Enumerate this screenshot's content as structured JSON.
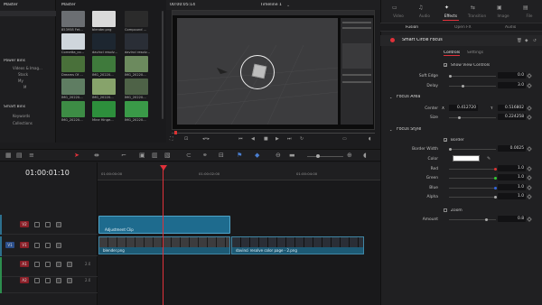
{
  "media_pool": {
    "master_label": "Master",
    "bins_master": "Master",
    "power_bins": "Power Bins",
    "power_items": [
      "Videos & Imag...",
      "Stock",
      "My",
      "M"
    ],
    "smart_bins": "Smart Bins",
    "smart_items": [
      "Keywords",
      "Collections"
    ],
    "thumbs": [
      {
        "label": "853958 Fet...",
        "color": "#6b6e72"
      },
      {
        "label": "blender.png",
        "color": "#dadada"
      },
      {
        "label": "Compound ...",
        "color": "#2b2b2b"
      },
      {
        "label": "Cornetta_co...",
        "color": "#cfd6dc"
      },
      {
        "label": "davinci resolv...",
        "color": "#1d2630"
      },
      {
        "label": "davinci resolv...",
        "color": "#2a2e36"
      },
      {
        "label": "Dreams Of ...",
        "color": "#49703a"
      },
      {
        "label": "IMG_20220...",
        "color": "#3f7a3c"
      },
      {
        "label": "IMG_20220...",
        "color": "#6c8a5e"
      },
      {
        "label": "IMG_20220...",
        "color": "#5f7d62"
      },
      {
        "label": "IMG_20220...",
        "color": "#87a36b"
      },
      {
        "label": "IMG_20220...",
        "color": "#4e6247"
      },
      {
        "label": "IMG_20220...",
        "color": "#3d8c45"
      },
      {
        "label": "Mine Hinge...",
        "color": "#2d8f3c"
      },
      {
        "label": "IMG_20220...",
        "color": "#3a9a48"
      }
    ]
  },
  "viewer": {
    "timecode": "00:00:05:14",
    "timeline_title": "Timeline 1"
  },
  "timeline": {
    "timecode": "01:00:01:10",
    "ruler": [
      "01:00:00:00",
      "01:00:02:00",
      "01:00:04:00"
    ],
    "tracks": [
      {
        "id": "V2",
        "clip": "Adjustment Clip"
      },
      {
        "id": "V1",
        "clip_a": "blender.png",
        "clip_b": "davinci resolve color page - 2.png"
      },
      {
        "id": "A1",
        "vol": "2.0"
      },
      {
        "id": "A2",
        "vol": "2.0"
      }
    ]
  },
  "inspector": {
    "tabs": [
      "Video",
      "Audio",
      "Effects",
      "Transition",
      "Image",
      "File"
    ],
    "active_tab": "Effects",
    "subtabs": [
      "Fusion",
      "Open FX",
      "Audio"
    ],
    "effect_name": "Smart Circle Focus",
    "control_tabs": [
      "Controls",
      "Settings"
    ],
    "show_view_controls": "Show View Controls",
    "soft_edge_label": "Soft Edge",
    "soft_edge": "0.0",
    "delay_label": "Delay",
    "delay": "3.0",
    "focus_area": "Focus Area",
    "center_label": "Center",
    "center_x_label": "X",
    "center_x": "0.412720",
    "center_y_label": "Y",
    "center_y": "0.516802",
    "size_label": "Size",
    "size": "0.224258",
    "focus_style": "Focus Style",
    "border_label": "Border",
    "border_width_label": "Border Width",
    "border_width": "0.0025",
    "color_label": "Color",
    "red_label": "Red",
    "red": "1.0",
    "green_label": "Green",
    "green": "1.0",
    "blue_label": "Blue",
    "blue": "1.0",
    "alpha_label": "Alpha",
    "alpha": "1.0",
    "zoom_label": "Zoom",
    "amount_label": "Amount",
    "amount": "0.8",
    "accent": "#e0313a"
  }
}
